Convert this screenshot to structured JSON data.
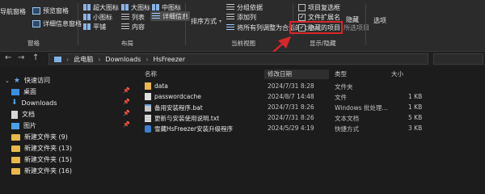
{
  "ribbon": {
    "panes_group": {
      "nav_pane": "导航窗格",
      "preview": "预览窗格",
      "details": "详细信息窗格",
      "label": "窗格"
    },
    "layout_group": {
      "items": [
        "超大图标",
        "大图标",
        "中图标",
        "小图标",
        "列表",
        "详细信息",
        "平铺",
        "内容"
      ],
      "label": "布局"
    },
    "view_group": {
      "sort": "排序方式",
      "group_by": "分组依据",
      "add_column": "添加列",
      "size_all": "将所有列调整为合适的大小",
      "label": "当前视图"
    },
    "showhide_group": {
      "item_checkboxes": "项目复选框",
      "file_ext": "文件扩展名",
      "hidden_items": "隐藏的项目",
      "hide_selected": "隐藏",
      "hide_selected_2": "所选项目",
      "label": "显示/隐藏"
    },
    "options": "选项"
  },
  "nav": {
    "back": "←",
    "forward": "→",
    "up": "↑",
    "path": [
      "此电脑",
      "Downloads",
      "HsFreezer"
    ]
  },
  "sidebar": {
    "items": [
      {
        "label": "快速访问",
        "icon": "star-icon",
        "pinned": false
      },
      {
        "label": "桌面",
        "icon": "desktop-icon",
        "pinned": true
      },
      {
        "label": "Downloads",
        "icon": "download-icon",
        "pinned": true
      },
      {
        "label": "文档",
        "icon": "document-icon",
        "pinned": true
      },
      {
        "label": "图片",
        "icon": "picture-icon",
        "pinned": true
      },
      {
        "label": "新建文件夹 (9)",
        "icon": "folder-icon",
        "pinned": false
      },
      {
        "label": "新建文件夹 (13)",
        "icon": "folder-icon",
        "pinned": false
      },
      {
        "label": "新建文件夹 (15)",
        "icon": "folder-icon",
        "pinned": false
      },
      {
        "label": "新建文件夹 (16)",
        "icon": "folder-icon",
        "pinned": false
      }
    ]
  },
  "files": {
    "columns": [
      "名称",
      "修改日期",
      "类型",
      "大小"
    ],
    "rows": [
      {
        "name": "data",
        "date": "2024/7/31 8:28",
        "type": "文件夹",
        "size": "",
        "icon": "folder-icon"
      },
      {
        "name": "passwordcache",
        "date": "2024/8/7 14:48",
        "type": "文件",
        "size": "1 KB",
        "icon": "file-icon"
      },
      {
        "name": "备用安装程序.bat",
        "date": "2024/7/31 8:26",
        "type": "Windows 批处理...",
        "size": "1 KB",
        "icon": "bat-icon"
      },
      {
        "name": "更新与安装使用说明.txt",
        "date": "2024/7/31 8:26",
        "type": "文本文档",
        "size": "5 KB",
        "icon": "txt-icon"
      },
      {
        "name": "雪藏HsFreezer安装升级程序",
        "date": "2024/5/29 4:19",
        "type": "快捷方式",
        "size": "3 KB",
        "icon": "shortcut-icon"
      }
    ]
  },
  "colors": {
    "highlight": "#d9262a",
    "accent": "#9cc9ff",
    "folder": "#e8b84a"
  }
}
